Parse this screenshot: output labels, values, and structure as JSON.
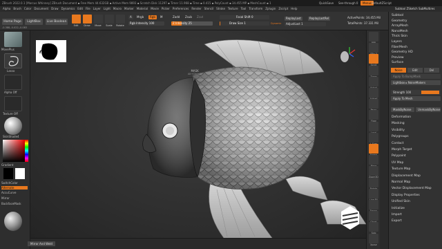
{
  "title_bar": {
    "text": "ZBrush 2022.0.1 [Marcus Whinney]   ZBrush Document    ▪ Free Mem 44.632GB ▪ Active Mem 9893 ▪ Scratch Disk 11297 ▪ Timer 11.968 ▪ Time ▪ 0.415 ▪ PolyCount ▪ 34.455 MP ▪ MeshCount ▪ 1",
    "quicksave": "QuickSave",
    "seethrough": "See-through  0",
    "menus_btn": "Menus",
    "script": "DefaultZScript"
  },
  "menu_bar": {
    "items": [
      "Alpha",
      "Brush",
      "Color",
      "Document",
      "Draw",
      "Dynamics",
      "Edit",
      "File",
      "Layer",
      "Light",
      "Macro",
      "Marker",
      "Material",
      "Movie",
      "Picker",
      "Preferences",
      "Render",
      "Stencil",
      "Stroke",
      "Texture",
      "Tool",
      "Transform",
      "Zplugin",
      "Zscript",
      "Help"
    ],
    "right": "Subtool  ZSketch  SubMultires"
  },
  "shelf": {
    "home_page": "Home Page",
    "lightbox": "LightBox",
    "live_boolean": "Live Boolean",
    "tools": [
      {
        "label": "Edit",
        "on": true
      },
      {
        "label": "Draw",
        "on": true
      },
      {
        "label": "Move",
        "on": false
      },
      {
        "label": "Scale",
        "on": false
      },
      {
        "label": "Rotate",
        "on": false
      }
    ],
    "a_label": "A",
    "mrgb": "Mrgb",
    "rgb": "Rgb",
    "m": "M",
    "zadd": "Zadd",
    "zsub": "Zsub",
    "zcut": "Zcut",
    "rgb_intensity": "Rgb Intensity 100",
    "z_intensity": "Z Intensity 25",
    "focal_shift": "Focal Shift 0",
    "draw_size": "Draw Size 1",
    "dynamic": "Dynamic",
    "replay_last": "ReplayLast",
    "replay_last_rel": "ReplayLastRel",
    "adjust_last": "AdjustLast 1",
    "active_points": "ActivePoints: 34.455 Mil",
    "total_points": "TotalPoints: 37.331 Mil",
    "coords": "-0.388,-0.022,-0.083"
  },
  "left_tray": {
    "brush_label": "MovePlus",
    "stroke_label": "Lasso",
    "alpha_label": "Alpha Off",
    "texture_label": "Texture Off",
    "material_label": "SkinShade4",
    "gradient_label": "Gradient",
    "switch_color": "SwitchColor",
    "alternate": "Alternate",
    "accucurve": "AccuCurve",
    "mirror": "Mirror",
    "backface_mask": "BackfaceMask"
  },
  "canvas": {
    "mask_label": "MASK",
    "mask_sub": "Alt+Ctrl+Cl"
  },
  "bottom_bar": {
    "mirror_weld": "Mirror And Weld"
  },
  "icon_strip": [
    "BPR",
    "SPix 3",
    "Scroll",
    "Zoom",
    "Actual",
    "AAHalf",
    "Persp",
    "Floor",
    "Local",
    "L.Sym",
    "Frame",
    "Move",
    "Zoom3D",
    "Rotate",
    "Line Fill PolyF",
    "Transp",
    "Ghost",
    "Solo",
    "Xpose"
  ],
  "palette": {
    "top_items": [
      "Subtool",
      "Geometry",
      "ArrayMesh",
      "NanoMesh",
      "Thick Skin",
      "Layers",
      "FiberMesh",
      "Geometry HD",
      "Preview",
      "Surface"
    ],
    "noise_btn": "Noise",
    "edit_btn": "Edit",
    "del_btn": "Del",
    "noise_to_bump": "Apply To BumpMask",
    "lightbox_noisemakers": "Lightbox ▸ NoiseMakers",
    "strength": "Strength 100",
    "apply_to_mesh": "Apply To Mesh",
    "mask_by_noise": "MaskByNoise",
    "unmask_by_noise": "UnmaskByNoise",
    "bottom_items": [
      "Deformation",
      "Masking",
      "Visibility",
      "Polygroups",
      "Contact",
      "Morph Target",
      "Polypaint",
      "UV Map",
      "Texture Map",
      "Displacement Map",
      "Normal Map",
      "Vector Displacement Map",
      "Display Properties",
      "Unified Skin",
      "Initialize",
      "Import",
      "Export"
    ]
  },
  "colors": {
    "accent": "#e8781e",
    "background": "#262626",
    "panel": "#323232"
  }
}
